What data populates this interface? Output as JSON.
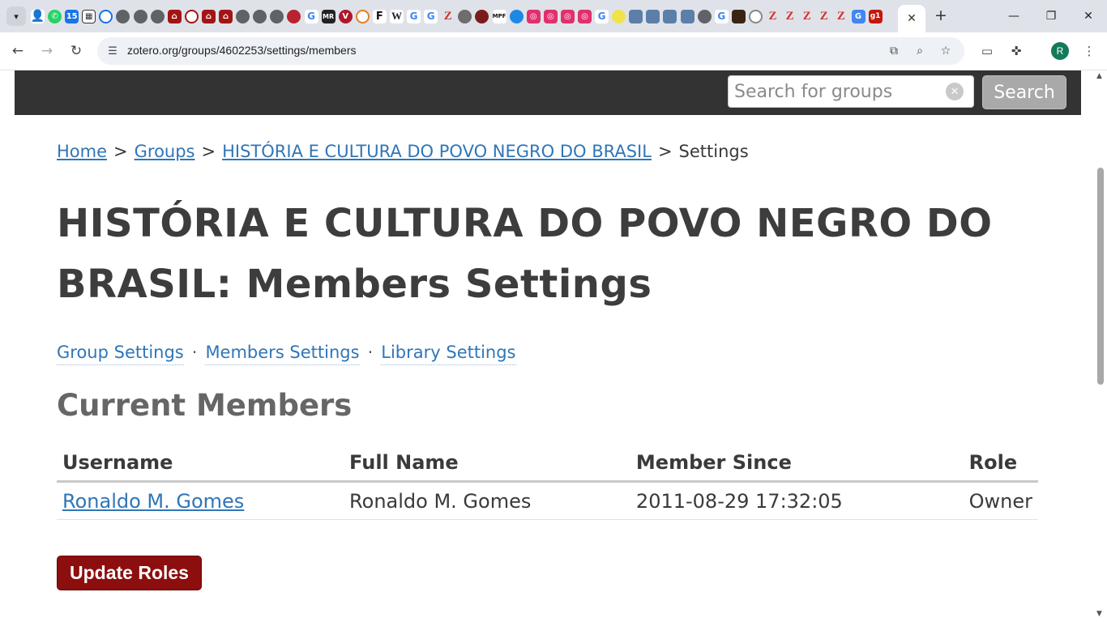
{
  "browser": {
    "url": "zotero.org/groups/4602253/settings/members",
    "active_tab_close": "✕",
    "new_tab": "+",
    "profile_initial": "R",
    "window_controls": {
      "minimize": "—",
      "restore": "❐",
      "close": "✕"
    },
    "pinned_tab_labels": [
      "15",
      "MR",
      "W",
      "MPF",
      "g1"
    ]
  },
  "header": {
    "search_placeholder": "Search for groups",
    "search_button": "Search"
  },
  "breadcrumb": {
    "home": "Home",
    "separator": ">",
    "groups": "Groups",
    "group": "HISTÓRIA E CULTURA DO POVO NEGRO DO BRASIL",
    "current": "Settings"
  },
  "page": {
    "title": "HISTÓRIA E CULTURA DO POVO NEGRO DO BRASIL: Members Settings",
    "subnav": {
      "group_settings": "Group Settings",
      "members_settings": "Members Settings",
      "library_settings": "Library Settings",
      "separator": "·"
    },
    "section_title": "Current Members",
    "table": {
      "columns": [
        "Username",
        "Full Name",
        "Member Since",
        "Role"
      ],
      "rows": [
        {
          "username": "Ronaldo M. Gomes",
          "full_name": "Ronaldo M. Gomes",
          "member_since": "2011-08-29 17:32:05",
          "role": "Owner"
        }
      ]
    },
    "update_button": "Update Roles"
  },
  "colors": {
    "header_bg": "#333333",
    "link": "#2f76b8",
    "update_button_bg": "#8c0e0e",
    "search_button_bg": "#a9a9a9",
    "profile_avatar": "#137a5c"
  }
}
